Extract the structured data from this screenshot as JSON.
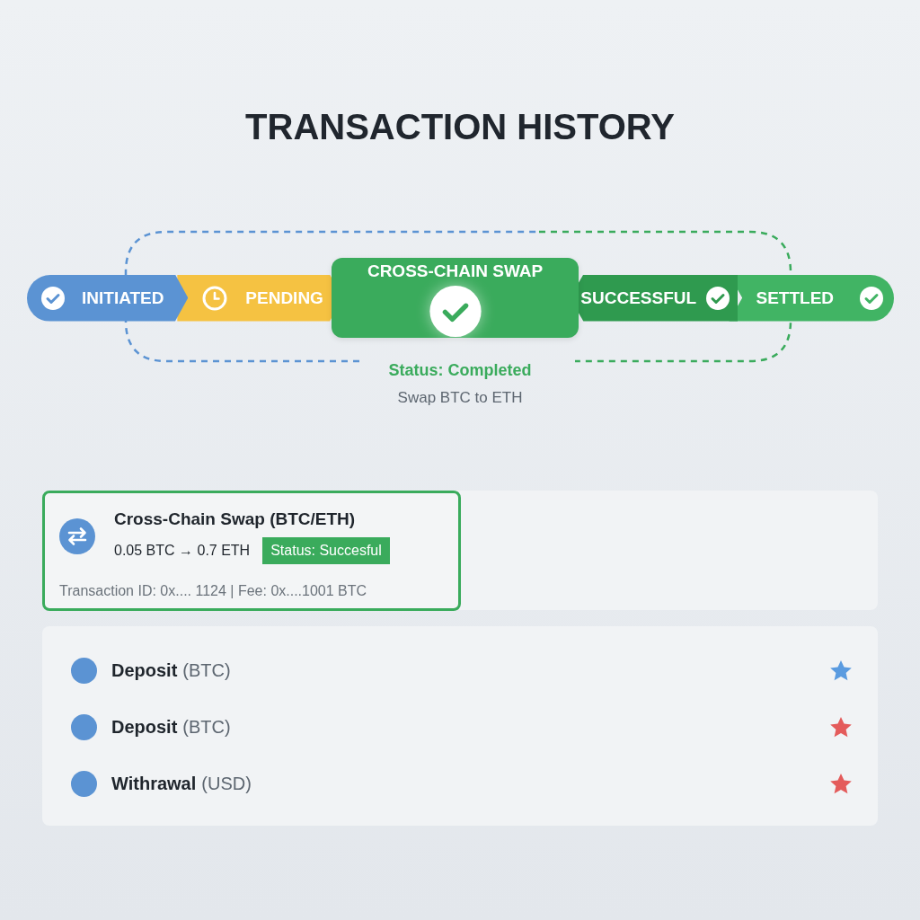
{
  "title": "TRANSACTION HISTORY",
  "pipeline": {
    "stages": [
      {
        "kind": "done",
        "label": "INITIATED",
        "color": "#5b93d3"
      },
      {
        "kind": "pending",
        "label": "PENDING",
        "color": "#f5c242"
      },
      {
        "kind": "center",
        "label": "CROSS-CHAIN SWAP",
        "color": "#3aab5c"
      },
      {
        "kind": "complete",
        "label": "SUCCESSFUL",
        "color": "#2f9a4f"
      },
      {
        "kind": "complete",
        "label": "SETTLED",
        "color": "#41b464"
      }
    ],
    "status": "Status: Completed",
    "description": "Swap BTC to ETH"
  },
  "featured": {
    "title": "Cross-Chain Swap (BTC/ETH)",
    "amount": "0.05 BTC → 0.7 ETH",
    "badge": "Status: Succesful",
    "details": "Transaction ID: 0x.... 1124 | Fee: 0x....1001 BTC"
  },
  "transactions": [
    {
      "name": "Deposit",
      "currency": "(BTC)",
      "color": "#5a9be0"
    },
    {
      "name": "Deposit",
      "currency": "(BTC)",
      "color": "#e45b5b"
    },
    {
      "name": "Withrawal",
      "currency": "(USD)",
      "color": "#e45b5b"
    }
  ]
}
